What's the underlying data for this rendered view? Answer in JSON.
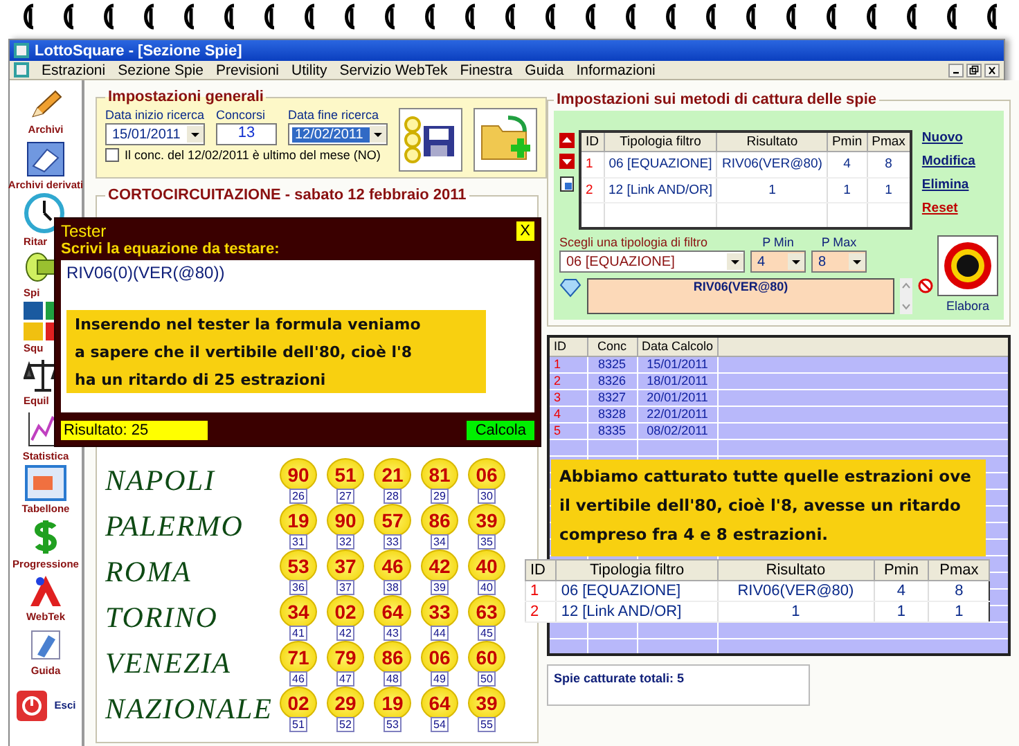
{
  "window": {
    "title": "LottoSquare - [Sezione Spie]"
  },
  "menu": [
    "Estrazioni",
    "Sezione Spie",
    "Previsioni",
    "Utility",
    "Servizio WebTek",
    "Finestra",
    "Guida",
    "Informazioni"
  ],
  "sidebar": [
    {
      "label": "Archivi",
      "kind": "stack"
    },
    {
      "label": "Archivi derivati",
      "kind": "stack"
    },
    {
      "label": "Ritar",
      "kind": "cut"
    },
    {
      "label": "Spi",
      "kind": "cut"
    },
    {
      "label": "Squ",
      "kind": "cut"
    },
    {
      "label": "Equil",
      "kind": "cut"
    },
    {
      "label": "Statistica",
      "kind": "stack"
    },
    {
      "label": "Tabellone",
      "kind": "stack"
    },
    {
      "label": "Progressione",
      "kind": "stack"
    },
    {
      "label": "WebTek",
      "kind": "stack"
    },
    {
      "label": "Guida",
      "kind": "stack"
    },
    {
      "label": "Esci",
      "kind": "inline"
    }
  ],
  "general": {
    "title": "Impostazioni generali",
    "fields": [
      {
        "label": "Data inizio ricerca",
        "value": "15/01/2011",
        "kind": "combo",
        "selected": false
      },
      {
        "label": "Concorsi",
        "value": "13",
        "kind": "text",
        "selected": false
      },
      {
        "label": "Data fine ricerca",
        "value": "12/02/2011",
        "kind": "combo",
        "selected": true
      }
    ],
    "checkbox": {
      "label": "Il conc. del 12/02/2011 è ultimo del mese (NO)",
      "checked": false
    }
  },
  "draw": {
    "title": "CORTOCIRCUITAZIONE - sabato 12 febbraio 2011",
    "wheels": [
      {
        "city": "NAPOLI",
        "numbers": [
          [
            "90",
            "26"
          ],
          [
            "51",
            "27"
          ],
          [
            "21",
            "28"
          ],
          [
            "81",
            "29"
          ],
          [
            "06",
            "30"
          ]
        ]
      },
      {
        "city": "PALERMO",
        "numbers": [
          [
            "19",
            "31"
          ],
          [
            "90",
            "32"
          ],
          [
            "57",
            "33"
          ],
          [
            "86",
            "34"
          ],
          [
            "39",
            "35"
          ]
        ]
      },
      {
        "city": "ROMA",
        "numbers": [
          [
            "53",
            "36"
          ],
          [
            "37",
            "37"
          ],
          [
            "46",
            "38"
          ],
          [
            "42",
            "39"
          ],
          [
            "40",
            "40"
          ]
        ]
      },
      {
        "city": "TORINO",
        "numbers": [
          [
            "34",
            "41"
          ],
          [
            "02",
            "42"
          ],
          [
            "64",
            "43"
          ],
          [
            "33",
            "44"
          ],
          [
            "63",
            "45"
          ]
        ]
      },
      {
        "city": "VENEZIA",
        "numbers": [
          [
            "71",
            "46"
          ],
          [
            "79",
            "47"
          ],
          [
            "86",
            "48"
          ],
          [
            "06",
            "49"
          ],
          [
            "60",
            "50"
          ]
        ]
      },
      {
        "city": "NAZIONALE",
        "numbers": [
          [
            "02",
            "51"
          ],
          [
            "29",
            "52"
          ],
          [
            "19",
            "53"
          ],
          [
            "64",
            "54"
          ],
          [
            "39",
            "55"
          ]
        ]
      }
    ]
  },
  "capture": {
    "title": "Impostazioni sui metodi di cattura delle spie",
    "columns": [
      "ID",
      "Tipologia filtro",
      "Risultato",
      "Pmin",
      "Pmax"
    ],
    "rows": [
      [
        "1",
        "06 [EQUAZIONE]",
        "RIV06(VER@80)",
        "4",
        "8"
      ],
      [
        "2",
        "12 [Link AND/OR]",
        "1",
        "1",
        "1"
      ]
    ],
    "links": [
      {
        "label": "Nuovo",
        "kind": "normal"
      },
      {
        "label": "Modifica",
        "kind": "normal"
      },
      {
        "label": "Elimina",
        "kind": "normal"
      },
      {
        "label": "Reset",
        "kind": "danger"
      }
    ],
    "filter_label": "Scegli una tipologia di filtro",
    "filter_value": "06 [EQUAZIONE]",
    "pmin_label": "P Min",
    "pmin_value": "4",
    "pmax_label": "P Max",
    "pmax_value": "8",
    "formula": "RIV06(VER@80)",
    "run_label": "Elabora"
  },
  "results": {
    "columns": [
      "ID",
      "Conc",
      "Data Calcolo"
    ],
    "rows": [
      [
        "1",
        "8325",
        "15/01/2011"
      ],
      [
        "2",
        "8326",
        "18/01/2011"
      ],
      [
        "3",
        "8327",
        "20/01/2011"
      ],
      [
        "4",
        "8328",
        "22/01/2011"
      ],
      [
        "5",
        "8335",
        "08/02/2011"
      ]
    ],
    "note": "Abbiamo catturato tutte quelle estrazioni ove il vertibile dell'80, cioè l'8, avesse un ritardo compreso fra 4 e 8 estrazioni.",
    "overlay_columns": [
      "ID",
      "Tipologia filtro",
      "Risultato",
      "Pmin",
      "Pmax"
    ],
    "overlay_rows": [
      [
        "1",
        "06 [EQUAZIONE]",
        "RIV06(VER@80)",
        "4",
        "8"
      ],
      [
        "2",
        "12 [Link AND/OR]",
        "1",
        "1",
        "1"
      ]
    ],
    "total": "Spie catturate totali: 5"
  },
  "tester": {
    "title": "Tester",
    "close": "X",
    "prompt": "Scrivi la equazione da testare:",
    "equation": "RIV06(0)(VER(@80))",
    "note": "Inserendo nel tester la formula veniamo\na sapere che il vertibile dell'80, cioè l'8\nha un ritardo di 25 estrazioni",
    "result": "Risultato: 25",
    "button": "Calcola"
  }
}
